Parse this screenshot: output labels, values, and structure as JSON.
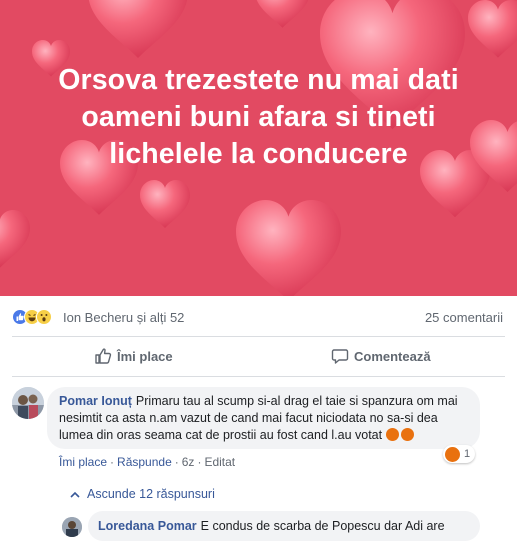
{
  "post": {
    "text_lines": [
      "Orsova trezestete nu mai dati",
      "oameni buni afara si tineti",
      "lichelele la conducere"
    ],
    "background_color": "#e24a62",
    "heart_color": "#f05a72"
  },
  "reactions": {
    "icons": [
      "like-icon",
      "haha-icon",
      "wow-icon"
    ],
    "names": "Ion Becheru și alți 52",
    "comments_count": "25 comentarii"
  },
  "actions": {
    "like_label": "Îmi place",
    "comment_label": "Comentează"
  },
  "comments": [
    {
      "author": "Pomar Ionuț",
      "text": "Primaru tau al scump si-al drag el taie si spanzura om mai nesimtit ca asta n.am vazut de cand mai facut niciodata no sa-si dea lumea din oras seama cat de prostii au fost cand l.au votat",
      "actions": {
        "like": "Îmi place",
        "reply": "Răspunde",
        "time": "6z",
        "edited": "Editat"
      },
      "reaction_count": "1",
      "hide_replies_label": "Ascunde 12 răspunsuri"
    },
    {
      "author": "Loredana Pomar",
      "text": "E condus de scarba de Popescu dar Adi are"
    }
  ]
}
